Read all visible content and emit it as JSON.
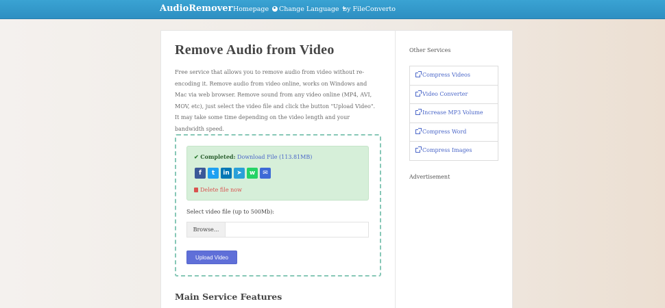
{
  "navbar": {
    "brand": "AudioRemover",
    "links": {
      "home": "Homepage",
      "language": "Change Language",
      "by": "by FileConverto"
    },
    "color": "#2d8fc2"
  },
  "main": {
    "title": "Remove Audio from Video",
    "intro": "Free service that allows you to remove audio from video without re-encoding it. Remove audio from video online, works on Windows and Mac via web browser. Remove sound from any video online (MP4, AVI, MOV, etc), just select the video file and click the button \"Upload Video\". It may take some time depending on the video length and your bandwidth speed.",
    "status": {
      "check_icon": "check-icon",
      "label": "Completed:",
      "download_link": "Download File (113.81MB)",
      "delete_link": "Delete file now"
    },
    "share": {
      "facebook": "f",
      "twitter": "t",
      "linkedin": "in",
      "telegram": "➤",
      "whatsapp": "w",
      "email": "✉"
    },
    "select_label": "Select video file (up to 500Mb):",
    "browse_label": "Browse...",
    "upload_label": "Upload Video",
    "features_title": "Main Service Features"
  },
  "sidebar": {
    "other_heading": "Other Services",
    "services": [
      "Compress Videos",
      "Video Converter",
      "Increase MP3 Volume",
      "Compress Word",
      "Compress Images"
    ],
    "ad_label": "Advertisement"
  }
}
